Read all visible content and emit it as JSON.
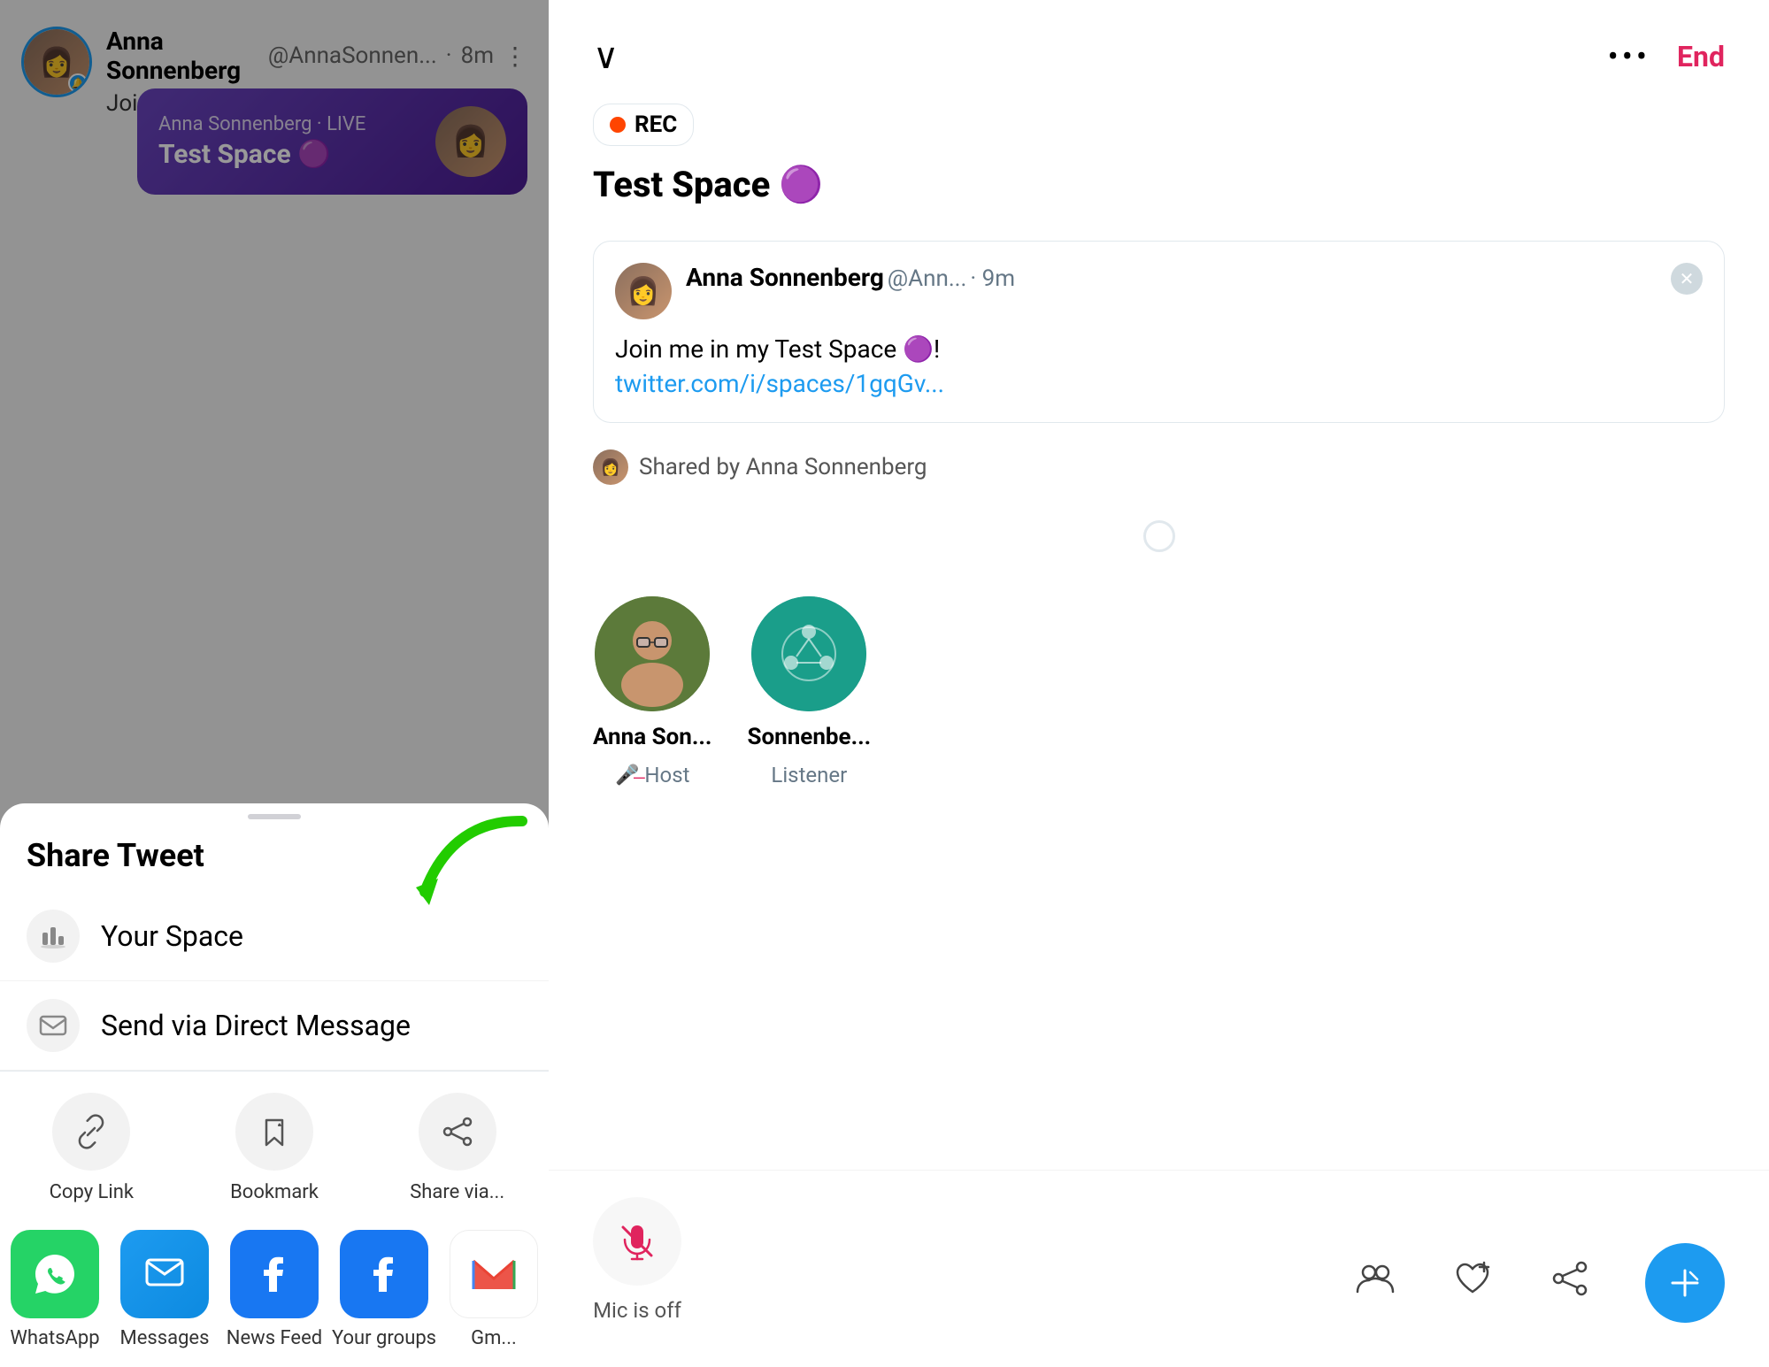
{
  "left": {
    "background_tweet": {
      "user_name": "Anna Sonnenberg",
      "user_handle": "@AnnaSonnen...",
      "time": "8m",
      "text": "Join me in my Test Space 🟣!",
      "space_card": {
        "host": "Anna Sonnenberg",
        "live_label": "Anna Sonnenberg · LIVE",
        "title": "Test Space 🟣"
      }
    },
    "sheet": {
      "title": "Share Tweet",
      "options": [
        {
          "icon": "🎙",
          "label": "Your Space"
        },
        {
          "icon": "✉",
          "label": "Send via Direct Message"
        }
      ],
      "icon_grid": [
        {
          "icon": "🔗",
          "label": "Copy Link"
        },
        {
          "icon": "🔖",
          "label": "Bookmark"
        },
        {
          "icon": "↗",
          "label": "Share via..."
        }
      ],
      "apps": [
        {
          "label": "WhatsApp",
          "color": "whatsapp"
        },
        {
          "label": "Messages",
          "color": "messages"
        },
        {
          "label": "News Feed",
          "color": "facebook"
        },
        {
          "label": "Your groups",
          "color": "facebook2"
        },
        {
          "label": "Gm...",
          "color": "gmail"
        }
      ]
    }
  },
  "right": {
    "header": {
      "chevron": "∨",
      "dots": "•••",
      "end_label": "End"
    },
    "rec_badge": {
      "label": "REC"
    },
    "space_title": "Test Space 🟣",
    "tweet_card": {
      "author_name": "Anna Sonnenberg",
      "author_handle": "@Ann...",
      "time": "9m",
      "text": "Join me in my Test Space 🟣!",
      "url": "twitter.com/i/spaces/1gqGv..."
    },
    "shared_by": "Shared by Anna Sonnenberg",
    "participants": [
      {
        "name": "Anna Son...",
        "role": "Host",
        "muted": true
      },
      {
        "name": "Sonnenbe...",
        "role": "Listener",
        "muted": false
      }
    ],
    "toolbar": {
      "mic_label": "Mic is off",
      "mic_state": "off"
    }
  }
}
